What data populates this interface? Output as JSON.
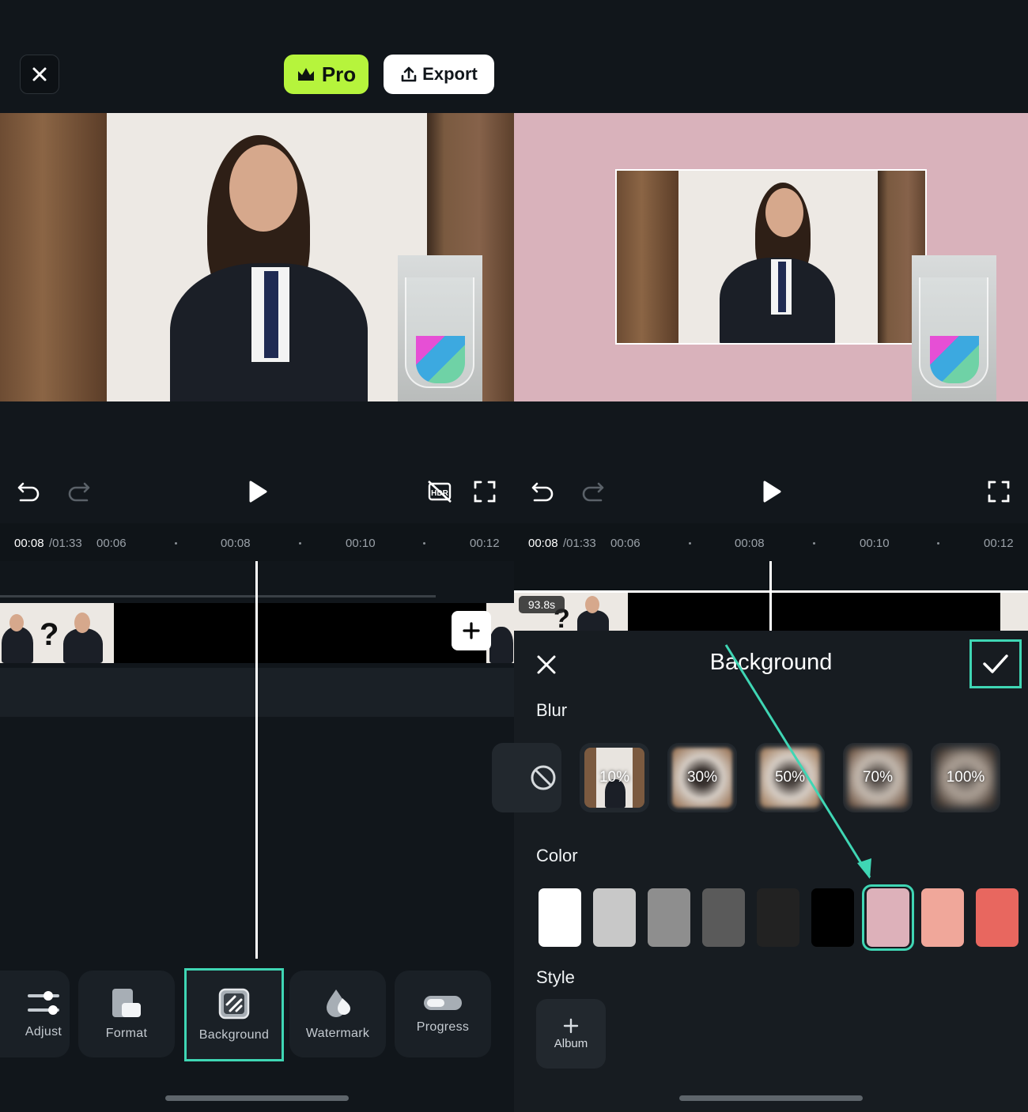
{
  "header": {
    "pro_label": "Pro",
    "export_label": "Export"
  },
  "timeline_left": {
    "current_time": "00:08",
    "total_time": "/01:33",
    "ticks": [
      "00:06",
      "00:08",
      "00:10",
      "00:12"
    ]
  },
  "timeline_right": {
    "current_time": "00:08",
    "total_time": "/01:33",
    "ticks": [
      "00:06",
      "00:08",
      "00:10",
      "00:12"
    ],
    "clip_duration": "93.8s"
  },
  "tools": [
    {
      "label": "Adjust",
      "icon": "sliders-icon"
    },
    {
      "label": "Format",
      "icon": "format-icon"
    },
    {
      "label": "Background",
      "icon": "background-icon",
      "selected": true
    },
    {
      "label": "Watermark",
      "icon": "watermark-drop-icon"
    },
    {
      "label": "Progress",
      "icon": "progress-toggle-icon"
    }
  ],
  "background_panel": {
    "title": "Background",
    "blur_label": "Blur",
    "blur_options": [
      "10%",
      "30%",
      "50%",
      "70%",
      "100%"
    ],
    "color_label": "Color",
    "colors": [
      "#ffffff",
      "#c8c8c8",
      "#8e8e8e",
      "#5a5a5a",
      "#222222",
      "#000000",
      "#ddb1ba",
      "#f0a79a",
      "#e8675f"
    ],
    "selected_color": "#ddb1ba",
    "style_label": "Style",
    "album_label": "Album"
  },
  "accent_color": "#3fd6b4",
  "pro_color": "#b6f43c"
}
